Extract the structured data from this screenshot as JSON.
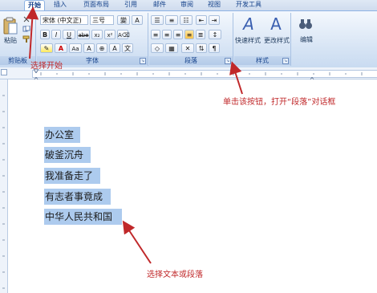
{
  "tabs": [
    "开始",
    "插入",
    "页面布局",
    "引用",
    "邮件",
    "审阅",
    "视图",
    "开发工具"
  ],
  "ribbon": {
    "clipboard": {
      "paste_label": "粘贴",
      "group_label": "剪贴板"
    },
    "font": {
      "font_name": "宋体 (中文正)",
      "font_size": "三号",
      "group_label": "字体"
    },
    "paragraph": {
      "group_label": "段落"
    },
    "styles": {
      "quick_label": "快速样式",
      "change_label": "更改样式",
      "group_label": "样式"
    },
    "editing": {
      "label": "编辑"
    }
  },
  "document": {
    "lines": [
      "办公室",
      "破釜沉舟",
      "我准备走了",
      "有志者事竟成",
      "中华人民共和国"
    ]
  },
  "annotations": {
    "select_start": "选择开始",
    "click_button": "单击该按钮，打开“段落”对话框",
    "select_text": "选择文本或段落"
  },
  "colors": {
    "annotation": "#c0282a",
    "selection": "#adcbee",
    "ribbon": "#d5e3f4"
  }
}
